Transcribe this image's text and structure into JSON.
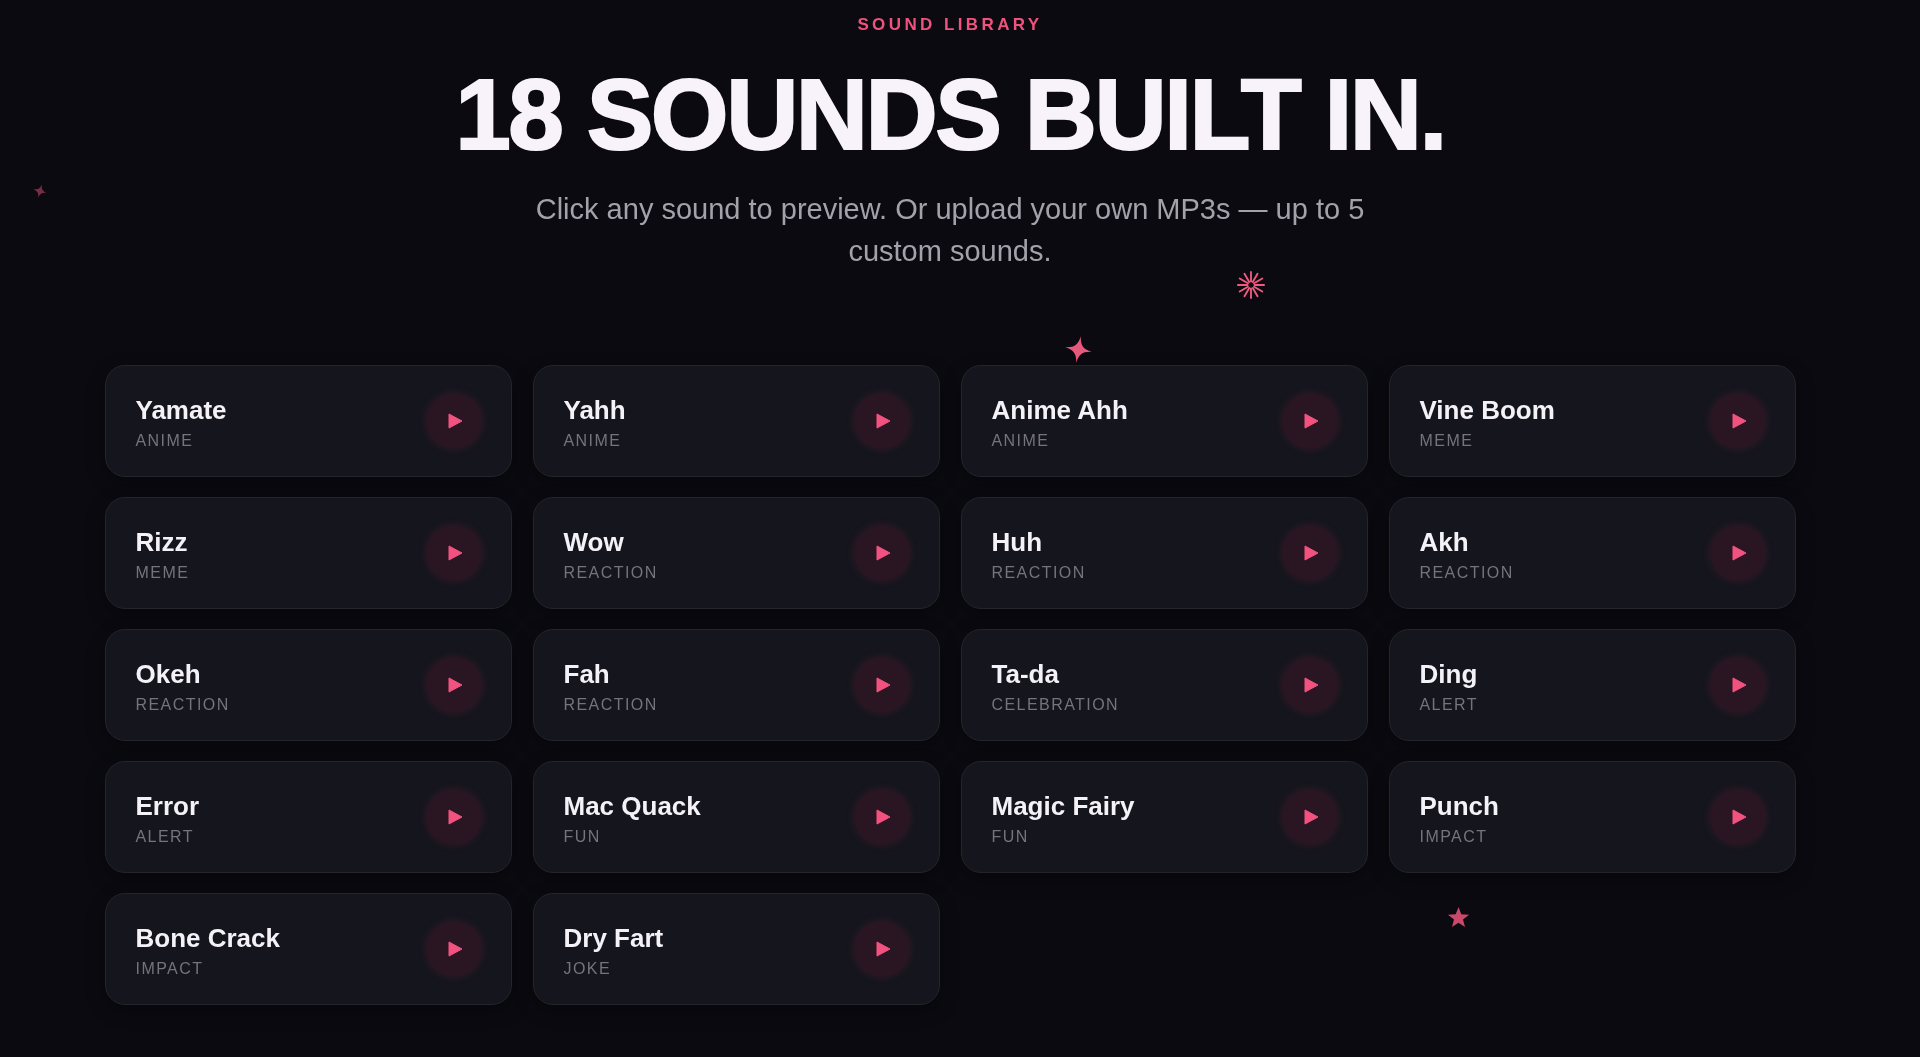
{
  "eyebrow": "SOUND LIBRARY",
  "title": "18 SOUNDS BUILT IN.",
  "subtitle": "Click any sound to preview. Or upload your own MP3s — up to 5 custom sounds.",
  "sounds": [
    {
      "name": "Yamate",
      "category": "ANIME"
    },
    {
      "name": "Yahh",
      "category": "ANIME"
    },
    {
      "name": "Anime Ahh",
      "category": "ANIME"
    },
    {
      "name": "Vine Boom",
      "category": "MEME"
    },
    {
      "name": "Rizz",
      "category": "MEME"
    },
    {
      "name": "Wow",
      "category": "REACTION"
    },
    {
      "name": "Huh",
      "category": "REACTION"
    },
    {
      "name": "Akh",
      "category": "REACTION"
    },
    {
      "name": "Okeh",
      "category": "REACTION"
    },
    {
      "name": "Fah",
      "category": "REACTION"
    },
    {
      "name": "Ta-da",
      "category": "CELEBRATION"
    },
    {
      "name": "Ding",
      "category": "ALERT"
    },
    {
      "name": "Error",
      "category": "ALERT"
    },
    {
      "name": "Mac Quack",
      "category": "FUN"
    },
    {
      "name": "Magic Fairy",
      "category": "FUN"
    },
    {
      "name": "Punch",
      "category": "IMPACT"
    },
    {
      "name": "Bone Crack",
      "category": "IMPACT"
    },
    {
      "name": "Dry Fart",
      "category": "JOKE"
    }
  ]
}
